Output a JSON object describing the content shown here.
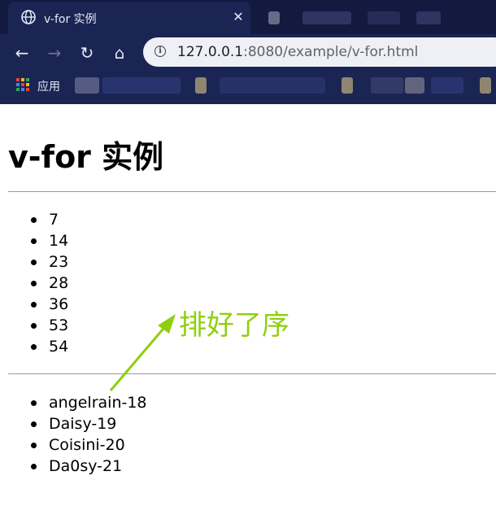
{
  "browser": {
    "tab": {
      "title": "v-for 实例",
      "close_glyph": "✕"
    },
    "nav": {
      "back": "←",
      "forward": "→",
      "reload": "↻",
      "home": "⌂"
    },
    "omnibox": {
      "host": "127.0.0.1",
      "rest": ":8080/example/v-for.html"
    },
    "bookmarks": {
      "apps_label": "应用"
    }
  },
  "page": {
    "title": "v-for 实例",
    "sorted_numbers": [
      "7",
      "14",
      "23",
      "28",
      "36",
      "53",
      "54"
    ],
    "people": [
      "angelrain-18",
      "Daisy-19",
      "Coisini-20",
      "Da0sy-21"
    ]
  },
  "annotation": {
    "text": "排好了序",
    "color": "#8fcf10"
  },
  "colors": {
    "chrome": "#1b2553",
    "tabstrip": "#121a3f",
    "annotation": "#8fcf10"
  },
  "icons": {
    "tab_favicon": "globe-icon",
    "info": "info-icon",
    "apps": "apps-grid-icon"
  }
}
